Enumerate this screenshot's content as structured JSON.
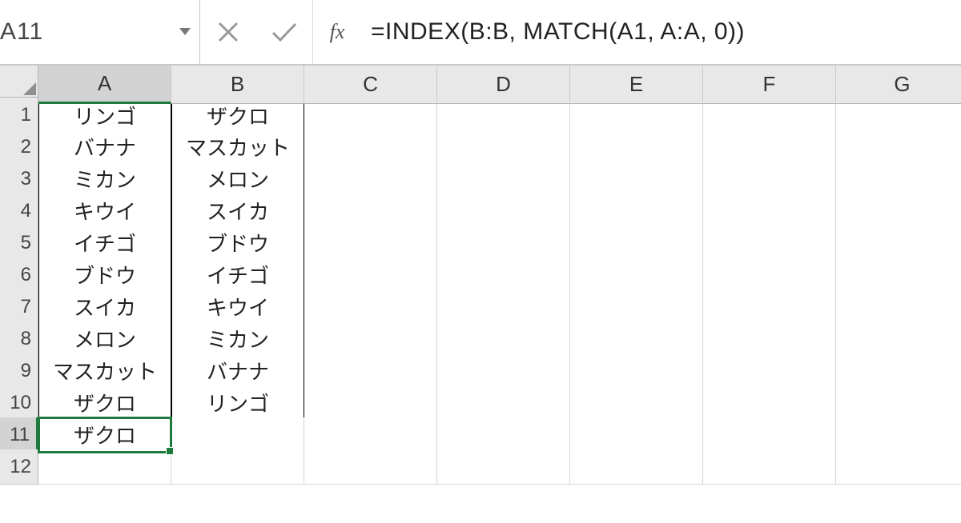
{
  "formula_bar": {
    "name_box": "A11",
    "fx_label": "fx",
    "formula": "=INDEX(B:B, MATCH(A1, A:A, 0))"
  },
  "columns": [
    "A",
    "B",
    "C",
    "D",
    "E",
    "F",
    "G"
  ],
  "row_numbers": [
    1,
    2,
    3,
    4,
    5,
    6,
    7,
    8,
    9,
    10,
    11,
    12
  ],
  "active_cell": {
    "col": "A",
    "row": 11
  },
  "sheet_data": {
    "A": [
      "リンゴ",
      "バナナ",
      "ミカン",
      "キウイ",
      "イチゴ",
      "ブドウ",
      "スイカ",
      "メロン",
      "マスカット",
      "ザクロ",
      "ザクロ",
      ""
    ],
    "B": [
      "ザクロ",
      "マスカット",
      "メロン",
      "スイカ",
      "ブドウ",
      "イチゴ",
      "キウイ",
      "ミカン",
      "バナナ",
      "リンゴ",
      "",
      ""
    ],
    "C": [
      "",
      "",
      "",
      "",
      "",
      "",
      "",
      "",
      "",
      "",
      "",
      ""
    ],
    "D": [
      "",
      "",
      "",
      "",
      "",
      "",
      "",
      "",
      "",
      "",
      "",
      ""
    ],
    "E": [
      "",
      "",
      "",
      "",
      "",
      "",
      "",
      "",
      "",
      "",
      "",
      ""
    ],
    "F": [
      "",
      "",
      "",
      "",
      "",
      "",
      "",
      "",
      "",
      "",
      "",
      ""
    ],
    "G": [
      "",
      "",
      "",
      "",
      "",
      "",
      "",
      "",
      "",
      "",
      "",
      ""
    ]
  },
  "data_border_range": {
    "cols": [
      "A",
      "B"
    ],
    "col_A_rows": 11,
    "col_B_rows": 10
  }
}
